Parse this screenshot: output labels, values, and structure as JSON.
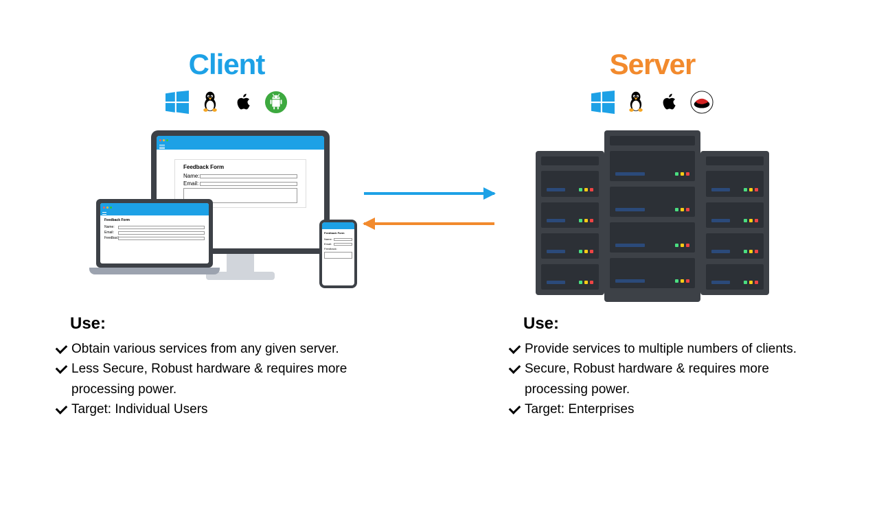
{
  "client": {
    "title": "Client",
    "os_icons": [
      "windows",
      "linux",
      "apple",
      "android"
    ],
    "form_title": "Feedback Form",
    "form_fields": {
      "name": "Name:",
      "email": "Email:",
      "feedback": "Feedback:"
    },
    "use_heading": "Use:",
    "use_points": [
      "Obtain various services from any given server.",
      "Less Secure, Robust hardware & requires more processing power.",
      "Target: Individual Users"
    ]
  },
  "server": {
    "title": "Server",
    "os_icons": [
      "windows",
      "linux",
      "apple",
      "redhat"
    ],
    "use_heading": "Use:",
    "use_points": [
      "Provide services to multiple numbers of clients.",
      "Secure, Robust hardware & requires more processing power.",
      "Target: Enterprises"
    ]
  }
}
